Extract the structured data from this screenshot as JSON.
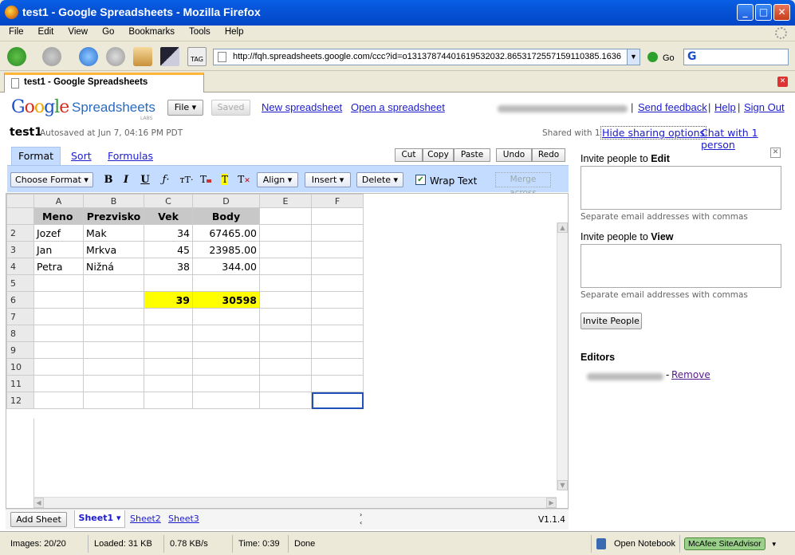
{
  "window": {
    "title": "test1 - Google Spreadsheets - Mozilla Firefox"
  },
  "menu": [
    "File",
    "Edit",
    "View",
    "Go",
    "Bookmarks",
    "Tools",
    "Help"
  ],
  "nav": {
    "url": "http://fqh.spreadsheets.google.com/ccc?id=o13137874401619532032.8653172557159110385.1636",
    "go_label": "Go"
  },
  "tab": {
    "title": "test1 - Google Spreadsheets"
  },
  "app": {
    "logo": "Google",
    "product": "Spreadsheets",
    "labs": "LABS",
    "file_btn": "File ▾",
    "saved_btn": "Saved",
    "new_link": "New spreadsheet",
    "open_link": "Open a spreadsheet",
    "send_feedback": "Send feedback",
    "help": "Help",
    "sign_out": "Sign Out",
    "sep": "|"
  },
  "doc": {
    "title": "test1",
    "autosave": "Autosaved at Jun 7, 04:16 PM PDT",
    "shared_with": "Shared with 1",
    "hide_sharing": "Hide sharing options",
    "chat": "Chat with 1 person"
  },
  "tabs": {
    "format": "Format",
    "sort": "Sort",
    "formulas": "Formulas"
  },
  "edit_buttons": {
    "cut": "Cut",
    "copy": "Copy",
    "paste": "Paste",
    "undo": "Undo",
    "redo": "Redo"
  },
  "format_bar": {
    "choose_format": "Choose Format ▾",
    "bold": "B",
    "italic": "I",
    "underline": "U",
    "font": "ƒ·",
    "size": "тT·",
    "align": "Align ▾",
    "insert": "Insert ▾",
    "delete": "Delete ▾",
    "wrap_text": "Wrap Text",
    "wrap_checked": true,
    "merge_across": "Merge across"
  },
  "grid": {
    "columns": [
      "A",
      "B",
      "C",
      "D",
      "E",
      "F"
    ],
    "header_row": [
      "Meno",
      "Prezvisko",
      "Vek",
      "Body"
    ],
    "rows": [
      {
        "num": "2",
        "cells": [
          "Jozef",
          "Mak",
          "34",
          "67465.00",
          "",
          ""
        ]
      },
      {
        "num": "3",
        "cells": [
          "Jan",
          "Mrkva",
          "45",
          "23985.00",
          "",
          ""
        ]
      },
      {
        "num": "4",
        "cells": [
          "Petra",
          "Nižná",
          "38",
          "344.00",
          "",
          ""
        ]
      },
      {
        "num": "5",
        "cells": [
          "",
          "",
          "",
          "",
          "",
          ""
        ]
      },
      {
        "num": "6",
        "cells": [
          "",
          "",
          "39",
          "30598",
          "",
          ""
        ]
      },
      {
        "num": "7",
        "cells": [
          "",
          "",
          "",
          "",
          "",
          ""
        ]
      },
      {
        "num": "8",
        "cells": [
          "",
          "",
          "",
          "",
          "",
          ""
        ]
      },
      {
        "num": "9",
        "cells": [
          "",
          "",
          "",
          "",
          "",
          ""
        ]
      },
      {
        "num": "10",
        "cells": [
          "",
          "",
          "",
          "",
          "",
          ""
        ]
      },
      {
        "num": "11",
        "cells": [
          "",
          "",
          "",
          "",
          "",
          ""
        ]
      },
      {
        "num": "12",
        "cells": [
          "",
          "",
          "",
          "",
          "",
          ""
        ]
      }
    ],
    "highlight_color": "#ffff00"
  },
  "sheets": {
    "add": "Add Sheet",
    "tabs": [
      "Sheet1 ▾",
      "Sheet2",
      "Sheet3"
    ],
    "version": "V1.1.4"
  },
  "sharing": {
    "invite_edit_prefix": "Invite people to ",
    "invite_edit_bold": "Edit",
    "invite_view_prefix": "Invite people to ",
    "invite_view_bold": "View",
    "hint": "Separate email addresses with commas",
    "invite_btn": "Invite People",
    "editors_title": "Editors",
    "remove_prefix": "- ",
    "remove": "Remove"
  },
  "status": {
    "images": "Images: 20/20",
    "loaded": "Loaded: 31 KB",
    "speed": "0.78 KB/s",
    "time": "Time: 0:39",
    "done": "Done",
    "notebook": "Open Notebook",
    "mcafee": "McAfee SiteAdvisor"
  }
}
